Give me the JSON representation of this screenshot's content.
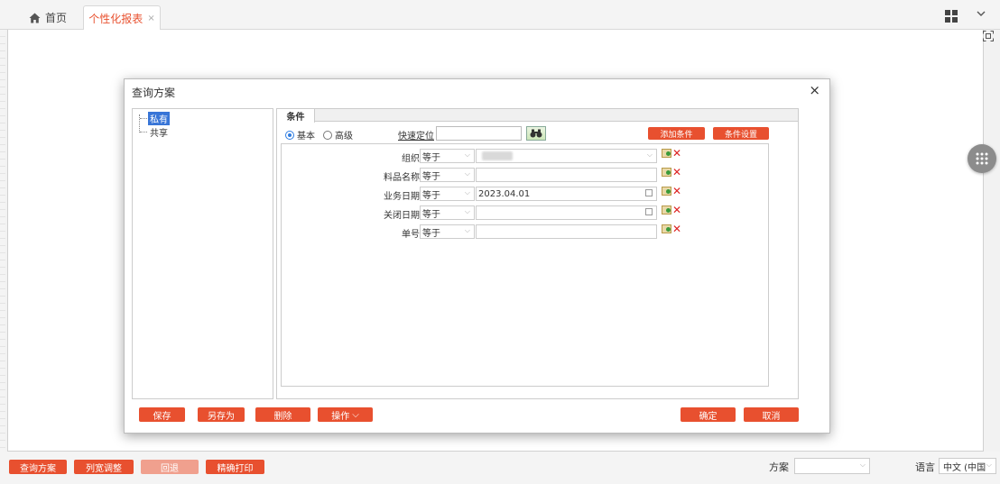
{
  "tabs": {
    "home_label": "首页",
    "active_label": "个性化报表",
    "active_close": "×"
  },
  "dialog": {
    "title": "查询方案",
    "close": "×",
    "tree": {
      "items": [
        {
          "label": "私有",
          "selected": true
        },
        {
          "label": "共享",
          "selected": false
        }
      ]
    },
    "conditions": {
      "tab_label": "条件",
      "mode_basic": "基本",
      "mode_advanced": "高级",
      "quick_locate_label": "快速定位",
      "quick_locate_value": "",
      "add_condition_label": "添加条件",
      "condition_settings_label": "条件设置",
      "rows": [
        {
          "field": "组织",
          "operator": "等于",
          "value": "",
          "kind": "select-blurred"
        },
        {
          "field": "料品名称",
          "operator": "等于",
          "value": "",
          "kind": "text"
        },
        {
          "field": "业务日期",
          "operator": "等于",
          "value": "2023.04.01",
          "kind": "date"
        },
        {
          "field": "关闭日期",
          "operator": "等于",
          "value": "",
          "kind": "date"
        },
        {
          "field": "单号",
          "operator": "等于",
          "value": "",
          "kind": "text"
        }
      ]
    },
    "buttons": {
      "save": "保存",
      "save_as": "另存为",
      "delete": "删除",
      "operate": "操作",
      "operate_caret": "⌵",
      "confirm": "确定",
      "cancel": "取消"
    }
  },
  "bottom": {
    "query_plan": "查询方案",
    "col_width": "列宽调整",
    "back": "回退",
    "precise_print": "精确打印",
    "plan_label": "方案",
    "plan_value": "",
    "lang_label": "语言",
    "lang_value": "中文 (中国"
  },
  "colors": {
    "accent": "#e8502f",
    "accent_disabled": "#f0a08e",
    "selection": "#3875d7",
    "radio": "#2f7de1"
  }
}
